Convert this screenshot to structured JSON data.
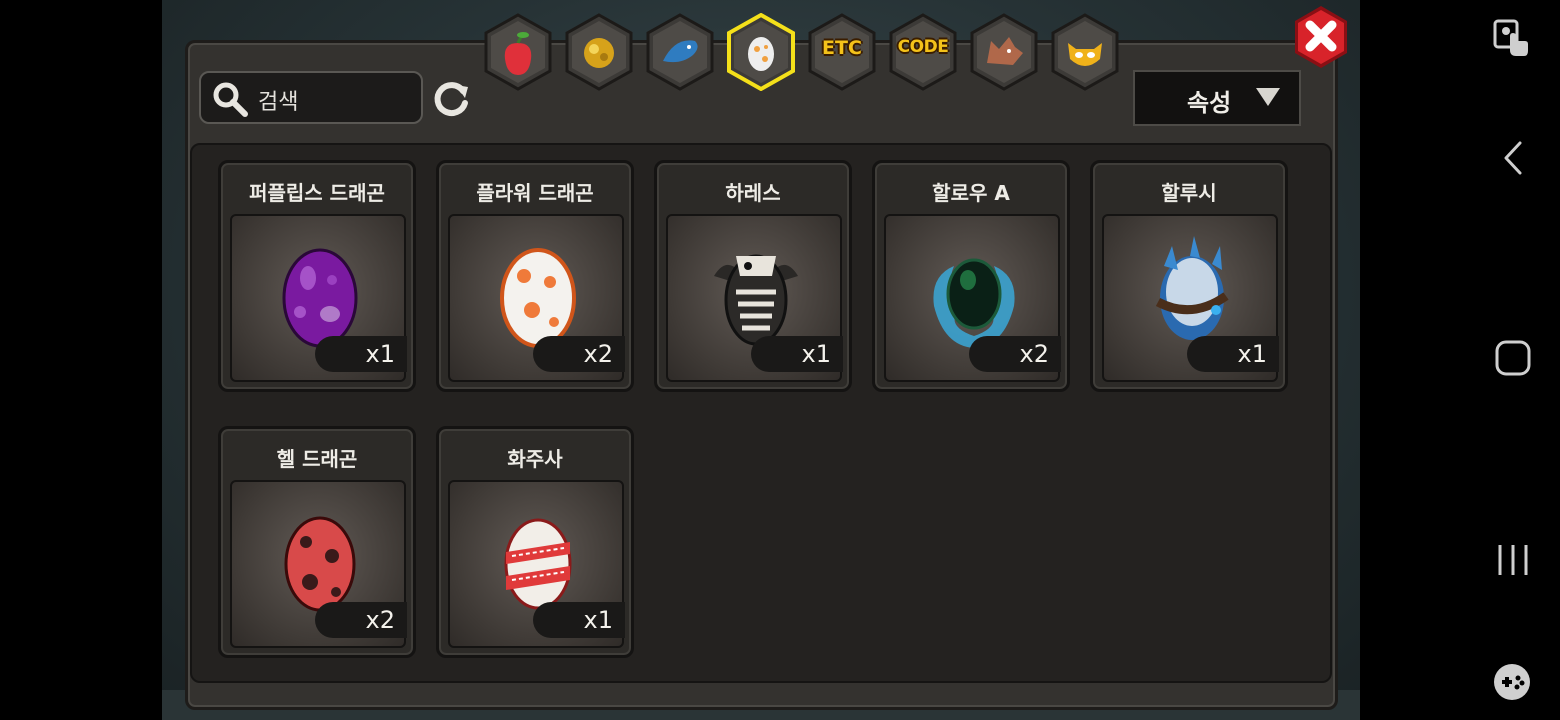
{
  "search": {
    "placeholder": "검색"
  },
  "filter": {
    "label": "속성"
  },
  "tabs": [
    {
      "name": "fruit-tab",
      "kind": "icon",
      "color": "#e0303a"
    },
    {
      "name": "gold-tab",
      "kind": "icon",
      "color": "#d6a21a"
    },
    {
      "name": "dragon-tab",
      "kind": "icon",
      "color": "#2f7cc0"
    },
    {
      "name": "egg-tab",
      "kind": "icon",
      "selected": true,
      "color": "#eeeeee"
    },
    {
      "name": "etc-tab",
      "kind": "text",
      "label": "ETC"
    },
    {
      "name": "code-tab",
      "kind": "text",
      "label": "CODE"
    },
    {
      "name": "wolf-tab",
      "kind": "icon",
      "color": "#b0684a"
    },
    {
      "name": "mask-tab",
      "kind": "icon",
      "color": "#f0b21a"
    }
  ],
  "items": [
    {
      "name": "퍼플립스 드래곤",
      "count": "x1",
      "egg": "purple"
    },
    {
      "name": "플라워 드래곤",
      "count": "x2",
      "egg": "flower"
    },
    {
      "name": "하레스",
      "count": "x1",
      "egg": "skeleton"
    },
    {
      "name": "할로우 A",
      "count": "x2",
      "egg": "hollow"
    },
    {
      "name": "할루시",
      "count": "x1",
      "egg": "spiked"
    },
    {
      "name": "헬 드래곤",
      "count": "x2",
      "egg": "hell"
    },
    {
      "name": "화주사",
      "count": "x1",
      "egg": "wrapped"
    }
  ],
  "colors": {
    "accent_yellow": "#f4e01a",
    "close_red": "#d8232a"
  }
}
